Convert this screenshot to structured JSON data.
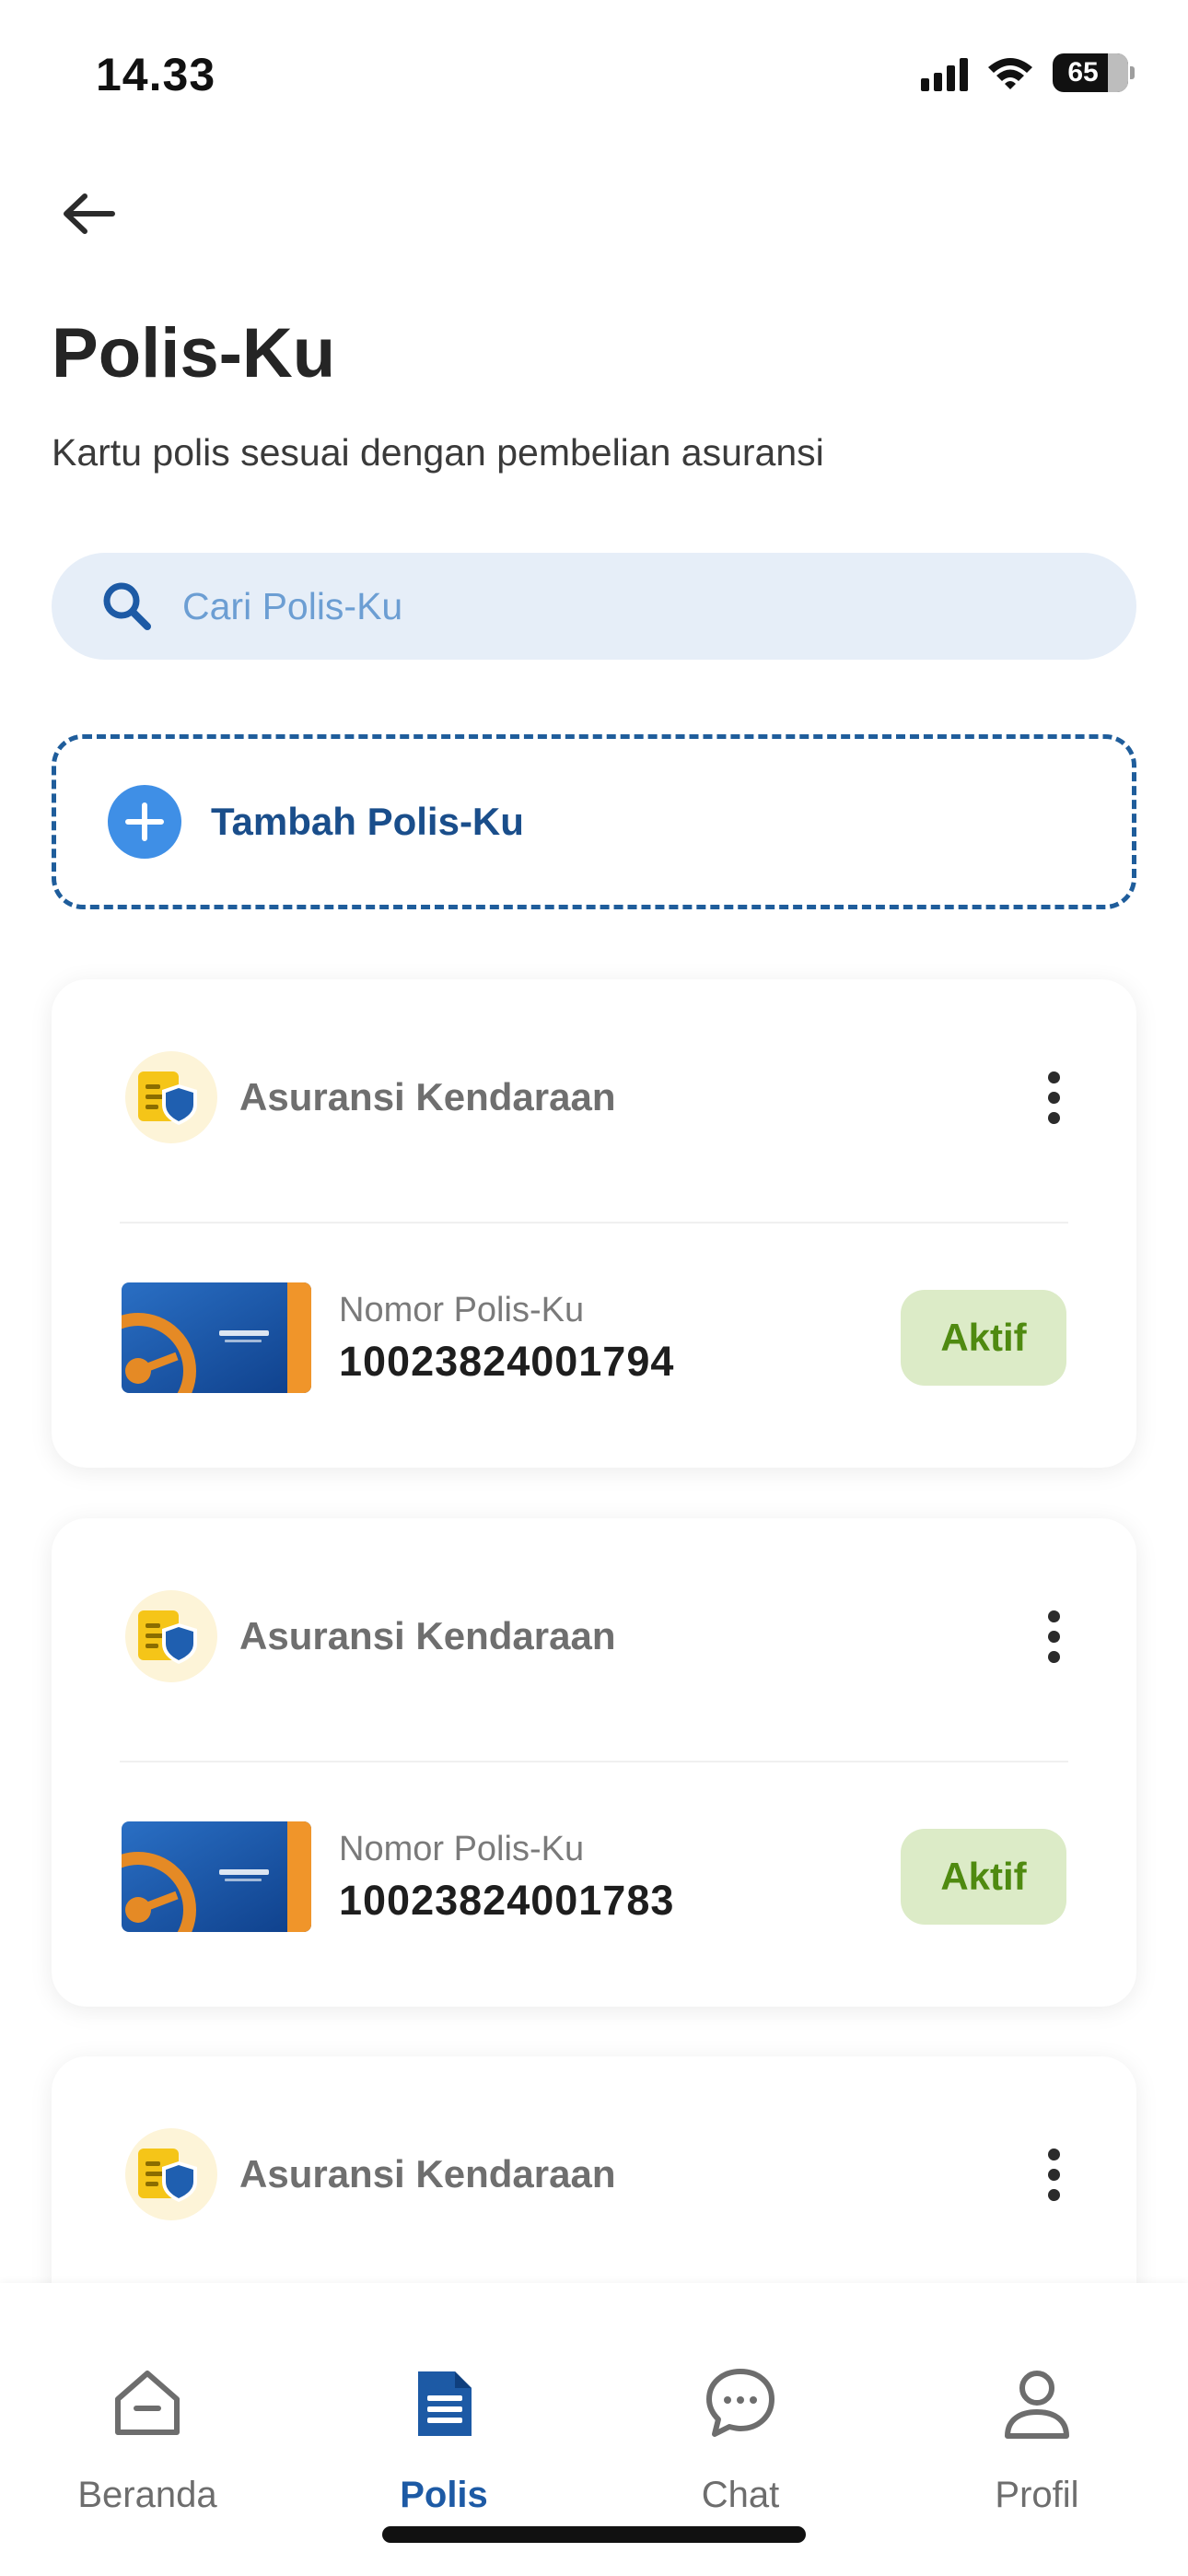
{
  "status_bar": {
    "time": "14.33",
    "battery": "65"
  },
  "header": {
    "back_icon": "arrow-left-icon",
    "title": "Polis-Ku",
    "subtitle": "Kartu polis sesuai dengan pembelian asuransi"
  },
  "search": {
    "icon": "search-icon",
    "placeholder": "Cari Polis-Ku",
    "value": ""
  },
  "add_policy": {
    "icon": "plus-icon",
    "label": "Tambah Polis-Ku"
  },
  "policies": [
    {
      "type": "Asuransi Kendaraan",
      "number_label": "Nomor Polis-Ku",
      "number": "10023824001794",
      "status": "Aktif"
    },
    {
      "type": "Asuransi Kendaraan",
      "number_label": "Nomor Polis-Ku",
      "number": "10023824001783",
      "status": "Aktif"
    },
    {
      "type": "Asuransi Kendaraan"
    }
  ],
  "bottom_nav": [
    {
      "label": "Beranda",
      "icon": "home-icon",
      "active": false
    },
    {
      "label": "Polis",
      "icon": "document-icon",
      "active": true
    },
    {
      "label": "Chat",
      "icon": "chat-icon",
      "active": false
    },
    {
      "label": "Profil",
      "icon": "profile-icon",
      "active": false
    }
  ],
  "colors": {
    "primary": "#1d5aa5",
    "accent_blue": "#3f8fe6",
    "search_bg": "#e6eef8",
    "badge_bg": "#dcebc7",
    "badge_text": "#4f8a10",
    "inactive": "#6d6d6d"
  }
}
